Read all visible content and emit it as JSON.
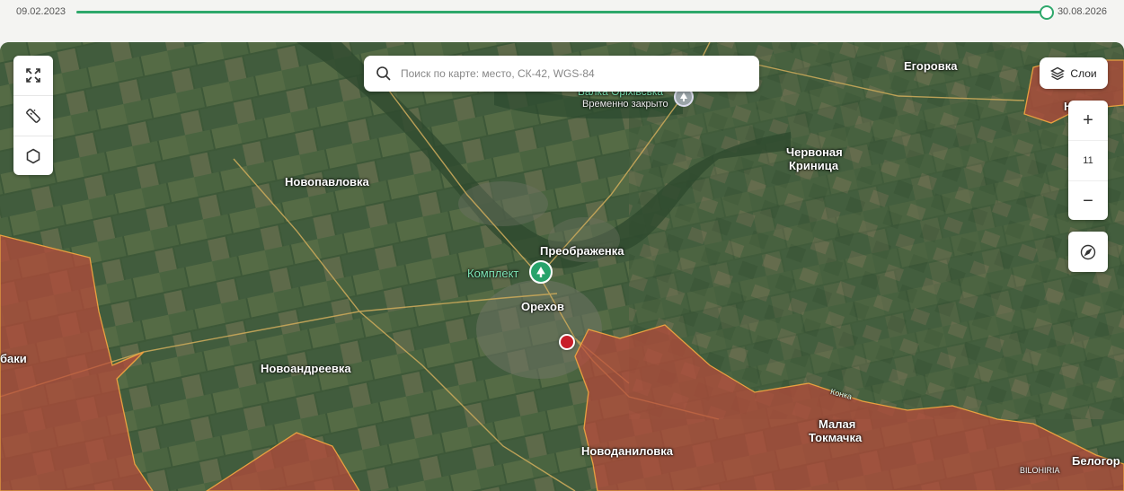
{
  "timeline": {
    "start_date": "09.02.2023",
    "end_date": "30.08.2026",
    "position_fraction": 1.0,
    "accent_color": "#2ea86b"
  },
  "search": {
    "placeholder": "Поиск по карте: место, СК-42, WGS-84",
    "icon": "search-icon"
  },
  "tools": [
    {
      "name": "fullscreen",
      "icon": "expand-icon"
    },
    {
      "name": "measure",
      "icon": "ruler-icon"
    },
    {
      "name": "polygon",
      "icon": "hexagon-icon"
    }
  ],
  "layers_button": {
    "label": "Слои",
    "icon": "layers-icon"
  },
  "zoom": {
    "plus": "+",
    "level": "11",
    "minus": "−"
  },
  "compass": {
    "icon": "compass-icon"
  },
  "places": {
    "egorovka": "Егоровка",
    "balka": "Балка Оріхівська",
    "balka_status": "Временно закрыто",
    "chervonaya_1": "Червоная",
    "chervonaya_2": "Криница",
    "novopavlovka": "Новопавловка",
    "preobrazhenka": "Преображенка",
    "komplekt": "Комплект",
    "orekhov": "Орехов",
    "baki": "баки",
    "novoandreevka": "Новоандреевка",
    "konka": "Конка",
    "malaya_1": "Малая",
    "malaya_2": "Токмачка",
    "novodanilovka": "Новоданиловка",
    "bilohiria": "BILOHIRIA",
    "belogor": "Белогор",
    "edge_right": "Н"
  },
  "colors": {
    "occupied_fill": "#b84a3a",
    "occupied_border": "#e8a040",
    "terrain": "#3f5a3c",
    "location_pin": "#c81e2a"
  }
}
